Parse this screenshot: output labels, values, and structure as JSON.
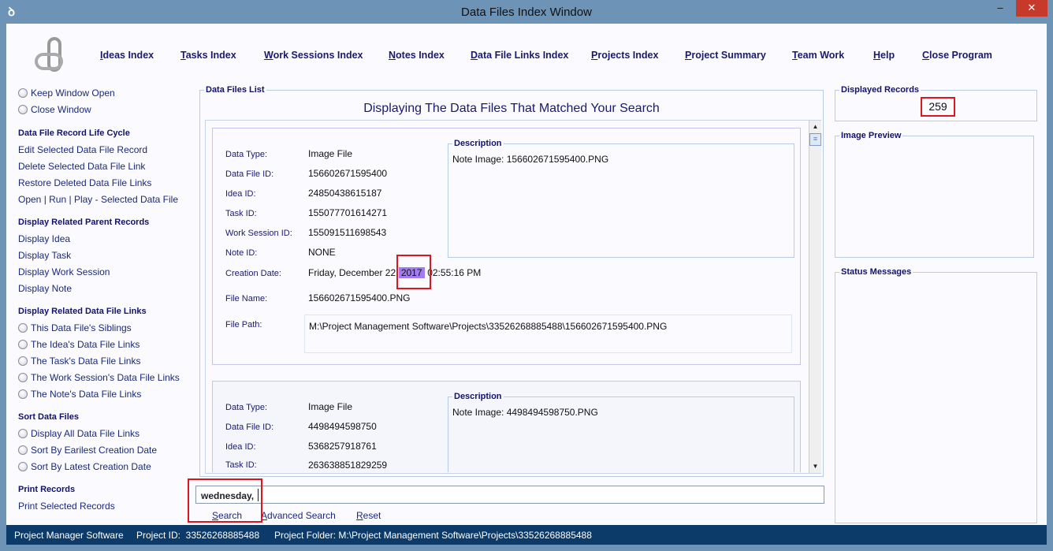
{
  "window": {
    "title": "Data Files Index Window",
    "minimize": "–",
    "maximize": "☐",
    "close": "✕"
  },
  "nav": [
    "Ideas Index",
    "Tasks Index",
    "Work Sessions Index",
    "Notes Index",
    "Data File Links Index",
    "Projects Index",
    "Project Summary",
    "Team Work",
    "Help",
    "Close Program"
  ],
  "sidebar": {
    "window_options": [
      "Keep Window Open",
      "Close Window"
    ],
    "sections": [
      {
        "title": "Data File Record Life Cycle",
        "items": [
          "Edit Selected Data File Record",
          "Delete Selected Data File Link",
          "Restore Deleted Data File Links",
          "Open | Run | Play - Selected Data File"
        ]
      },
      {
        "title": "Display Related Parent Records",
        "items": [
          "Display Idea",
          "Display Task",
          "Display Work Session",
          "Display Note"
        ]
      },
      {
        "title": "Display Related Data File Links",
        "items": [
          "This Data File's Siblings",
          "The Idea's Data File Links",
          "The Task's Data File Links",
          "The Work Session's Data File Links",
          "The Note's Data File Links"
        ]
      },
      {
        "title": "Sort Data Files",
        "items": [
          "Display All Data File Links",
          "Sort By Earilest Creation Date",
          "Sort By Latest Creation Date"
        ]
      },
      {
        "title": "Print Records",
        "items": [
          "Print Selected Records"
        ]
      }
    ]
  },
  "list": {
    "legend": "Data Files List",
    "heading": "Displaying The Data Files That Matched Your Search",
    "labels": {
      "type": "Data Type:",
      "file_id": "Data File ID:",
      "idea": "Idea ID:",
      "task": "Task ID:",
      "ws": "Work Session ID:",
      "note": "Note ID:",
      "created": "Creation Date:",
      "name": "File Name:",
      "path": "File Path:",
      "desc": "Description"
    },
    "records": [
      {
        "type": "Image File",
        "file_id": "156602671595400",
        "idea": "24850438615187",
        "task": "155077701614271",
        "ws": "155091511698543",
        "note": "NONE",
        "created_pre": "Friday, December 22,",
        "created_hl": " 2017 ",
        "created_post": " 02:55:16 PM",
        "name": "156602671595400.PNG",
        "path": "M:\\Project Management Software\\Projects\\33526268885488\\156602671595400.PNG",
        "desc": "Note Image: 156602671595400.PNG"
      },
      {
        "type": "Image File",
        "file_id": "4498494598750",
        "idea": "5368257918761",
        "task": "263638851829259",
        "desc": "Note Image: 4498494598750.PNG"
      }
    ]
  },
  "search": {
    "value": "wednesday,",
    "search": "Search",
    "advanced": "Advanced Search",
    "reset": "Reset"
  },
  "right": {
    "records_legend": "Displayed Records",
    "records_count": "259",
    "preview_legend": "Image Preview",
    "status_legend": "Status Messages"
  },
  "statusbar": {
    "app": "Project Manager Software",
    "project_id": "Project ID:  33526268885488",
    "folder": "Project Folder: M:\\Project Management Software\\Projects\\33526268885488"
  },
  "colors": {
    "highlight": "#a07cf0",
    "annotation": "#e0141e",
    "statusbar": "#0d3b69"
  }
}
